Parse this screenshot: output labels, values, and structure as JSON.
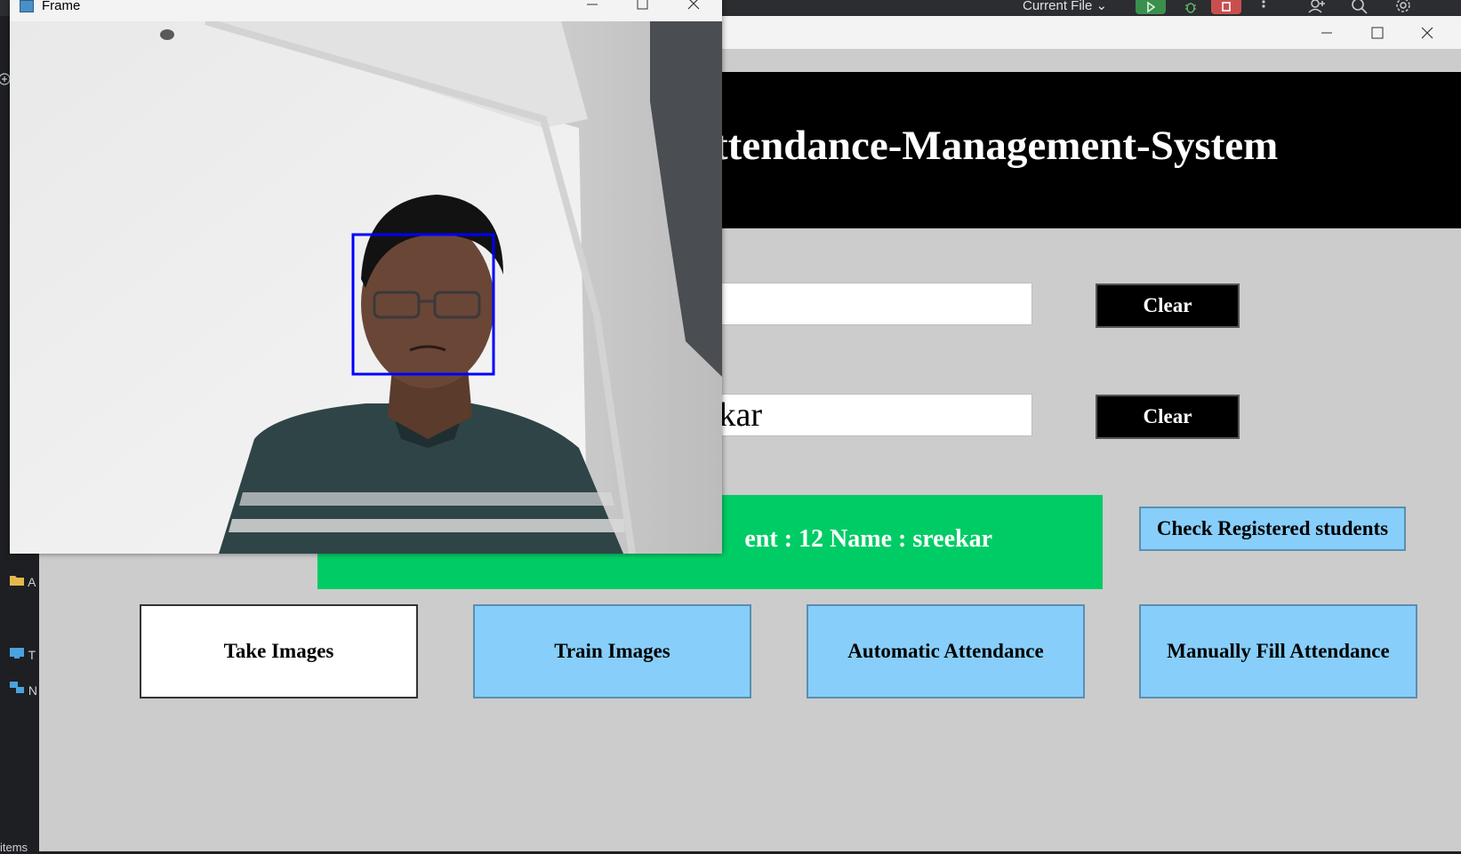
{
  "ide": {
    "run_config_label": "Current File",
    "sidebar_items": [
      "A",
      "T",
      "N"
    ],
    "status_text": "items"
  },
  "app": {
    "title": "Attendance-Management-System",
    "entry1_value": "",
    "entry2_value": "kar",
    "clear_label": "Clear",
    "notification": "ent : 12 Name : sreekar",
    "check_registered_label": "Check Registered students",
    "buttons": {
      "take_images": "Take Images",
      "train_images": "Train Images",
      "automatic_attendance": "Automatic Attendance",
      "manual_attendance": "Manually Fill Attendance"
    },
    "colors": {
      "header_bg": "#000000",
      "notification_bg": "#00cc66",
      "button_blue": "#87cefa",
      "window_bg": "#cccccc"
    }
  },
  "frame": {
    "title": "Frame",
    "face_box_color": "#0000ff"
  }
}
